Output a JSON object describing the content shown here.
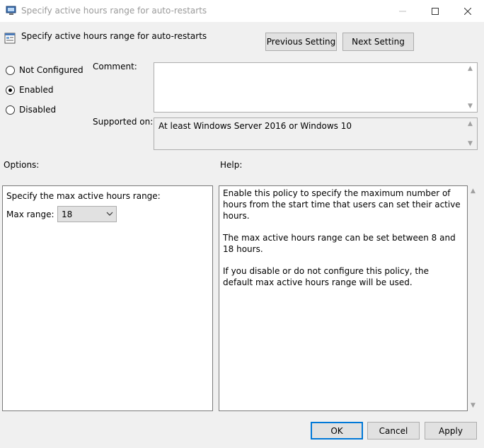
{
  "window": {
    "title": "Specify active hours range for auto-restarts",
    "controls": [
      "minimize-icon",
      "maximize-icon",
      "close-icon"
    ]
  },
  "header": {
    "policy_name": "Specify active hours range for auto-restarts",
    "prev_label": "Previous Setting",
    "next_label": "Next Setting"
  },
  "state": {
    "not_configured": "Not Configured",
    "enabled": "Enabled",
    "disabled": "Disabled",
    "selected": "Enabled"
  },
  "comment": {
    "label": "Comment:",
    "value": ""
  },
  "supported": {
    "label": "Supported on:",
    "value": "At least Windows Server 2016 or Windows 10"
  },
  "options": {
    "label": "Options:",
    "heading": "Specify the max active hours range:",
    "max_range_label": "Max range:",
    "max_range_value": "18"
  },
  "help": {
    "label": "Help:",
    "paragraphs": [
      "Enable this policy to specify the maximum number of hours from the start time that users can set their active hours.",
      "The max active hours range can be set between 8 and 18 hours.",
      "If you disable or do not configure this policy, the default max active hours range will be used."
    ]
  },
  "footer": {
    "ok": "OK",
    "cancel": "Cancel",
    "apply": "Apply"
  },
  "colors": {
    "accent": "#0078d7",
    "background": "#f0f0f0",
    "title_text": "#9a9a9a"
  }
}
